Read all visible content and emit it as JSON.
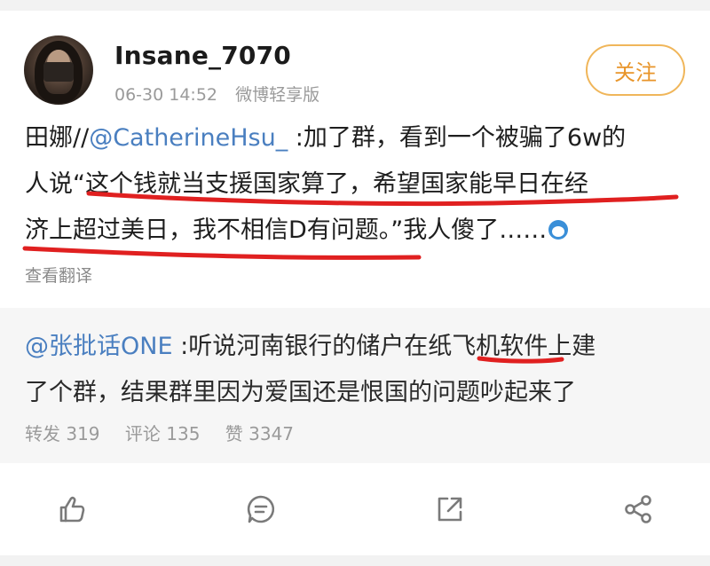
{
  "post": {
    "username": "Insane_7070",
    "timestamp": "06-30 14:52",
    "source": "微博轻享版",
    "follow_label": "关注",
    "text_prefix": "田娜//",
    "text_mention": "@CatherineHsu_",
    "text_line1_rest": " :加了群，看到一个被骗了6w的",
    "text_line2": "人说“这个钱就当支援国家算了，希望国家能早日在经",
    "text_line3": "济上超过美日，我不相信D有问题。”我人傻了……",
    "translate_label": "查看翻译",
    "emoji_icon": "doraemon-emoji-icon"
  },
  "repost": {
    "mention": "@张批话ONE",
    "text_line1_rest": " :听说河南银行的储户在纸飞机软件上建",
    "text_line2": "了个群，结果群里因为爱国还是恨国的问题吵起来了",
    "stats": {
      "reposts": "转发 319",
      "comments": "评论 135",
      "likes": "赞 3347"
    }
  },
  "actions": [
    "thumbs-up-icon",
    "comment-icon",
    "share-icon",
    "forward-icon"
  ],
  "colors": {
    "accent_orange": "#e8952a",
    "mention_blue": "#4a7fc0",
    "underline_red": "#e02020",
    "repost_bg": "#f6f6f6"
  }
}
